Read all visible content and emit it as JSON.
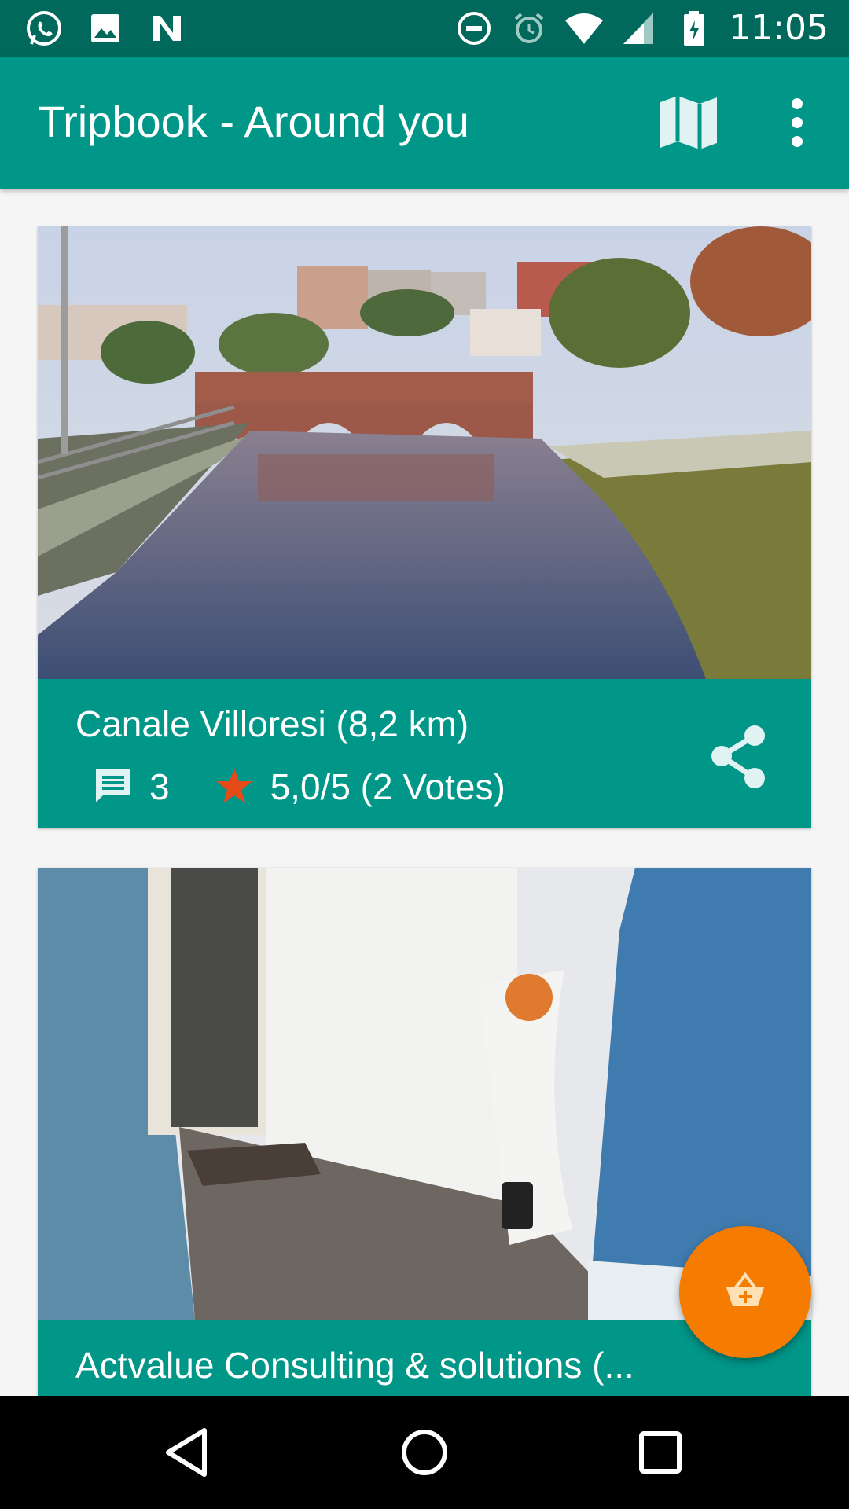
{
  "status_bar": {
    "time": "11:05",
    "left_icons": [
      "whatsapp-icon",
      "gallery-icon",
      "n-app-icon"
    ],
    "right_icons": [
      "do-not-disturb-icon",
      "alarm-icon",
      "wifi-icon",
      "signal-icon",
      "battery-icon"
    ]
  },
  "app_bar": {
    "title": "Tripbook - Around you",
    "actions": [
      "map-icon",
      "more-vert-icon"
    ],
    "color": "#009688"
  },
  "cards": [
    {
      "name": "Canale Villoresi (8,2 km)",
      "comments": "3",
      "rating": "5,0/5 (2 Votes)"
    },
    {
      "name": "Actvalue Consulting & solutions (..."
    }
  ],
  "fab": {
    "icon": "add-basket-icon",
    "color": "#F57C00"
  },
  "nav": [
    "back-icon",
    "home-icon",
    "recents-icon"
  ]
}
